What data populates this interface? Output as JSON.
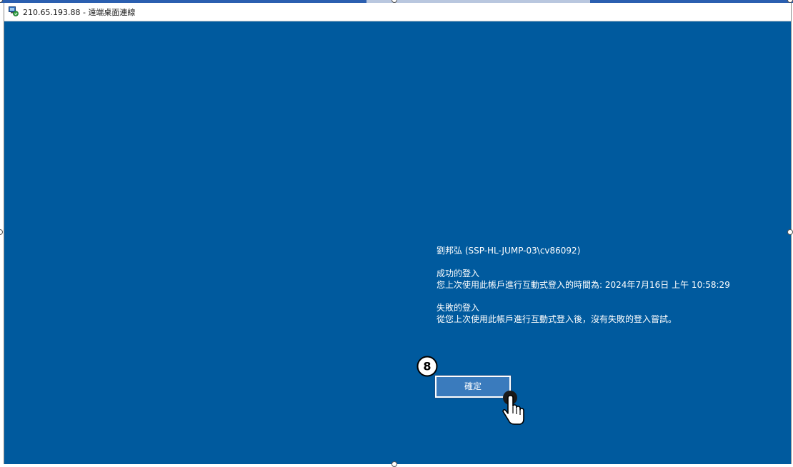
{
  "window": {
    "title": "210.65.193.88 - 遠端桌面連線",
    "icon": "remote-desktop-icon"
  },
  "login_info": {
    "user_line": "劉邦弘 (SSP-HL-JUMP-03\\cv86092)",
    "success_heading": "成功的登入",
    "success_detail": "您上次使用此帳戶進行互動式登入的時間為: 2024年7月16日 上午 10:58:29",
    "failed_heading": "失敗的登入",
    "failed_detail": "從您上次使用此帳戶進行互動式登入後，沒有失敗的登入嘗試。"
  },
  "ok_button": {
    "label": "確定"
  },
  "annotation": {
    "step_number": "8",
    "icon": "hand-pointer-icon"
  },
  "colors": {
    "desktop_background": "#005a9e",
    "button_background": "#3a7bbd",
    "text": "#ffffff"
  }
}
